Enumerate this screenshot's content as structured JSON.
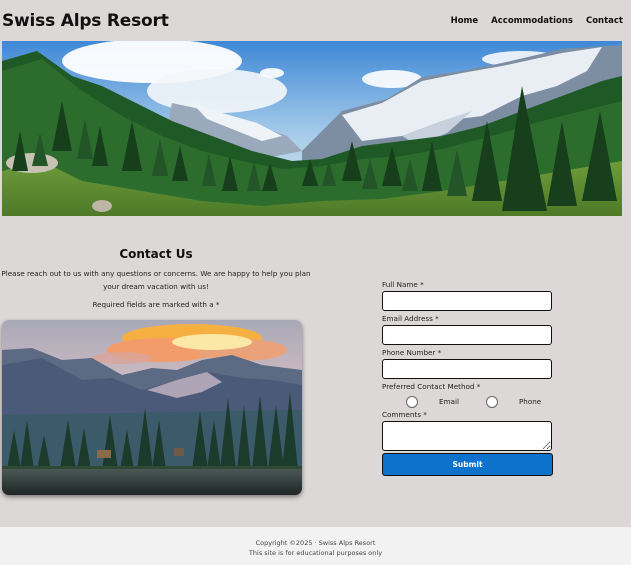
{
  "header": {
    "site_title": "Swiss Alps Resort",
    "nav": [
      "Home",
      "Accommodations",
      "Contact"
    ]
  },
  "contact": {
    "heading": "Contact Us",
    "intro_line1": "Please reach out to us with any questions or concerns. We are happy to help you plan",
    "intro_line2": "your dream vacation with us!",
    "required_note": "Required fields are marked with a *"
  },
  "form": {
    "full_name_label": "Full Name *",
    "full_name_value": "",
    "email_label": "Email Address *",
    "email_value": "",
    "phone_label": "Phone Number *",
    "phone_value": "",
    "contact_method_label": "Preferred Contact Method *",
    "contact_options": [
      "Email",
      "Phone"
    ],
    "comments_label": "Comments *",
    "comments_value": "",
    "submit_label": "Submit"
  },
  "footer": {
    "copyright": "Copyright ©2025 · Swiss Alps Resort",
    "disclaimer": "This site is for educational purposes only"
  },
  "colors": {
    "page_background": "#dcd8d7",
    "footer_background": "#f2f2f2",
    "submit_button": "#0c72cc"
  }
}
